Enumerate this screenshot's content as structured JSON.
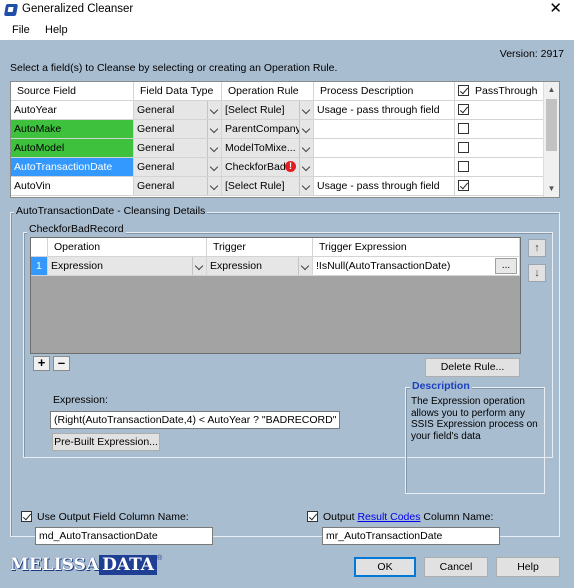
{
  "window": {
    "title": "Generalized Cleanser",
    "close_glyph": "✕"
  },
  "menu": {
    "items": [
      "File",
      "Help"
    ]
  },
  "version": "Version: 2917",
  "instruction": "Select a field(s) to Cleanse by selecting or creating an Operation Rule.",
  "fields_grid": {
    "headers": [
      "Source Field",
      "Field Data Type",
      "Operation Rule",
      "Process Description",
      "PassThrough"
    ],
    "header_pass_checked": true,
    "rows": [
      {
        "source": "AutoYear",
        "type": "General",
        "rule": "[Select Rule]",
        "desc": "Usage - pass through field",
        "pass": true,
        "highlight": "none",
        "warning": false
      },
      {
        "source": "AutoMake",
        "type": "General",
        "rule": "ParentCompany",
        "desc": "",
        "pass": false,
        "highlight": "green",
        "warning": false
      },
      {
        "source": "AutoModel",
        "type": "General",
        "rule": "ModelToMixe...",
        "desc": "",
        "pass": false,
        "highlight": "green",
        "warning": false
      },
      {
        "source": "AutoTransactionDate",
        "type": "General",
        "rule": "CheckforBad...",
        "desc": "",
        "pass": false,
        "highlight": "blue",
        "warning": true
      },
      {
        "source": "AutoVin",
        "type": "General",
        "rule": "[Select Rule]",
        "desc": "Usage - pass through field",
        "pass": true,
        "highlight": "none",
        "warning": false
      }
    ]
  },
  "details": {
    "group_title": "AutoTransactionDate - Cleansing Details",
    "rule_group_title": "CheckforBadRecord",
    "rules_headers": [
      "Operation",
      "Trigger",
      "Trigger Expression"
    ],
    "rules_rows": [
      {
        "num": "1",
        "operation": "Expression",
        "trigger": "Expression",
        "expression": "!IsNull(AutoTransactionDate)",
        "ellipsis": "..."
      }
    ],
    "move_up_glyph": "↑",
    "move_down_glyph": "↓",
    "add_glyph": "+",
    "remove_glyph": "–",
    "delete_rule_label": "Delete Rule...",
    "expression_label": "Expression:",
    "expression_value": "(Right(AutoTransactionDate,4) < AutoYear ? \"BADRECORD\" : Auto",
    "prebuilt_label": "Pre-Built Expression...",
    "description_title": "Description",
    "description_text": "The Expression operation allows you to perform any SSIS Expression process on your field's data"
  },
  "output": {
    "use_output_label": "Use Output Field Column Name:",
    "use_output_checked": true,
    "output_field_value": "md_AutoTransactionDate",
    "result_prefix": "Output",
    "result_link": "Result Codes",
    "result_suffix": "Column Name:",
    "result_checked": true,
    "result_field_value": "mr_AutoTransactionDate"
  },
  "logo": {
    "part1": "MELISSA",
    "part2": "DATA",
    "mark": "®"
  },
  "buttons": {
    "ok": "OK",
    "cancel": "Cancel",
    "help": "Help"
  },
  "colors": {
    "client_bg": "#a9bdd0",
    "green_highlight": "#3ec23e",
    "blue_selection": "#3399ff",
    "link": "#1a3fbf"
  }
}
